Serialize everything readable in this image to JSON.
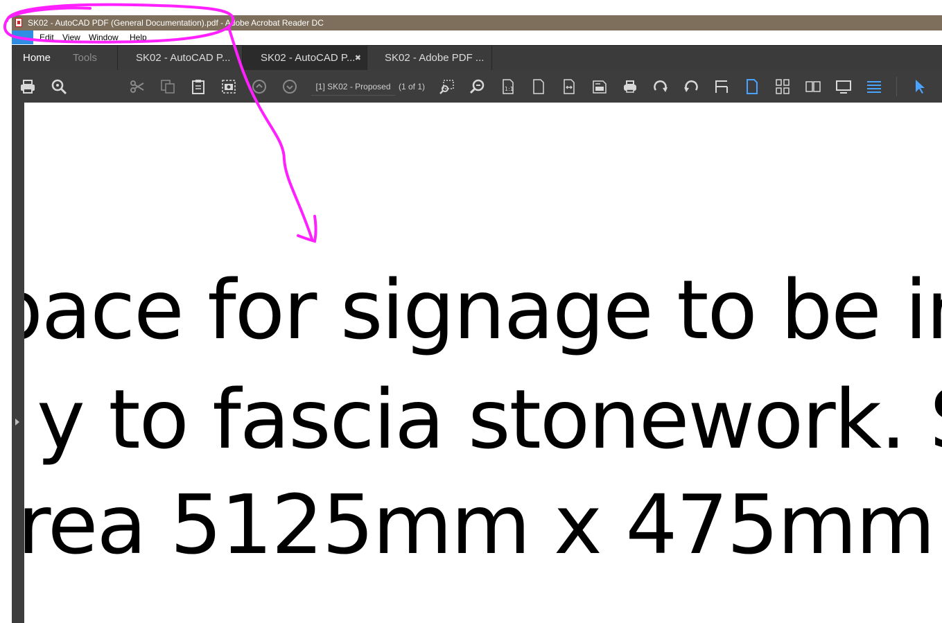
{
  "window": {
    "title": "SK02 - AutoCAD PDF (General Documentation).pdf - Adobe Acrobat Reader DC",
    "icon": "pdf-file-icon"
  },
  "menu": {
    "file": "File",
    "edit": "Edit",
    "view": "View",
    "window": "Window",
    "help": "Help"
  },
  "tabs": {
    "home": "Home",
    "tools": "Tools",
    "doc1": "SK02 - AutoCAD P...",
    "doc2": "SK02 - AutoCAD P...",
    "doc2_close": "✖",
    "doc3": "SK02 - Adobe PDF ..."
  },
  "toolbar": {
    "page_label": "[1] SK02 - Proposed",
    "page_count": "(1 of 1)",
    "icons": [
      "print-icon",
      "zoom-search-icon",
      "cut-icon",
      "copy-icon",
      "paste-icon",
      "snapshot-icon",
      "previous-page-icon",
      "next-page-icon",
      "marquee-zoom-icon",
      "zoom-icon",
      "actual-size-icon",
      "fit-page-icon",
      "fit-width-icon",
      "fit-visible-icon",
      "print-toolbar-icon",
      "rotate-clockwise-icon",
      "rotate-counterclockwise-icon",
      "split-icon",
      "single-page-icon",
      "continuous-icon",
      "two-page-icon",
      "presentation-icon",
      "reading-mode-icon",
      "select-cursor-icon"
    ]
  },
  "document": {
    "line1": "pace for signage to be in",
    "line2": "y to fascia stonework. S",
    "line3": "rea 5125mm x 475mm"
  },
  "annotation": {
    "color": "#ff20ff",
    "type": "hand-drawn circle and arrow"
  },
  "colors": {
    "titlebar": "#7d6f5b",
    "toolbar": "#3d3d3d",
    "accent": "#4aa3ff"
  }
}
